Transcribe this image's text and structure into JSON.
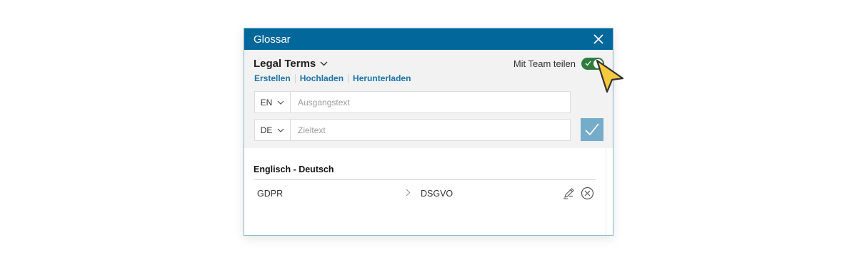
{
  "dialog": {
    "title": "Glossar"
  },
  "glossary": {
    "name": "Legal Terms",
    "actions": [
      "Erstellen",
      "Hochladen",
      "Herunterladen"
    ],
    "share_label": "Mit Team teilen",
    "share_enabled": true
  },
  "entry_form": {
    "source_lang": "EN",
    "source_placeholder": "Ausgangstext",
    "source_value": "",
    "target_lang": "DE",
    "target_placeholder": "Zieltext",
    "target_value": ""
  },
  "list": {
    "pair_header": "Englisch - Deutsch",
    "entries": [
      {
        "source": "GDPR",
        "target": "DSGVO"
      }
    ]
  },
  "colors": {
    "title_bar": "#02679a",
    "toggle_on": "#2f7c3f",
    "link": "#1b74a8",
    "confirm_button": "#75acc9",
    "cursor": "#f5c93d"
  }
}
